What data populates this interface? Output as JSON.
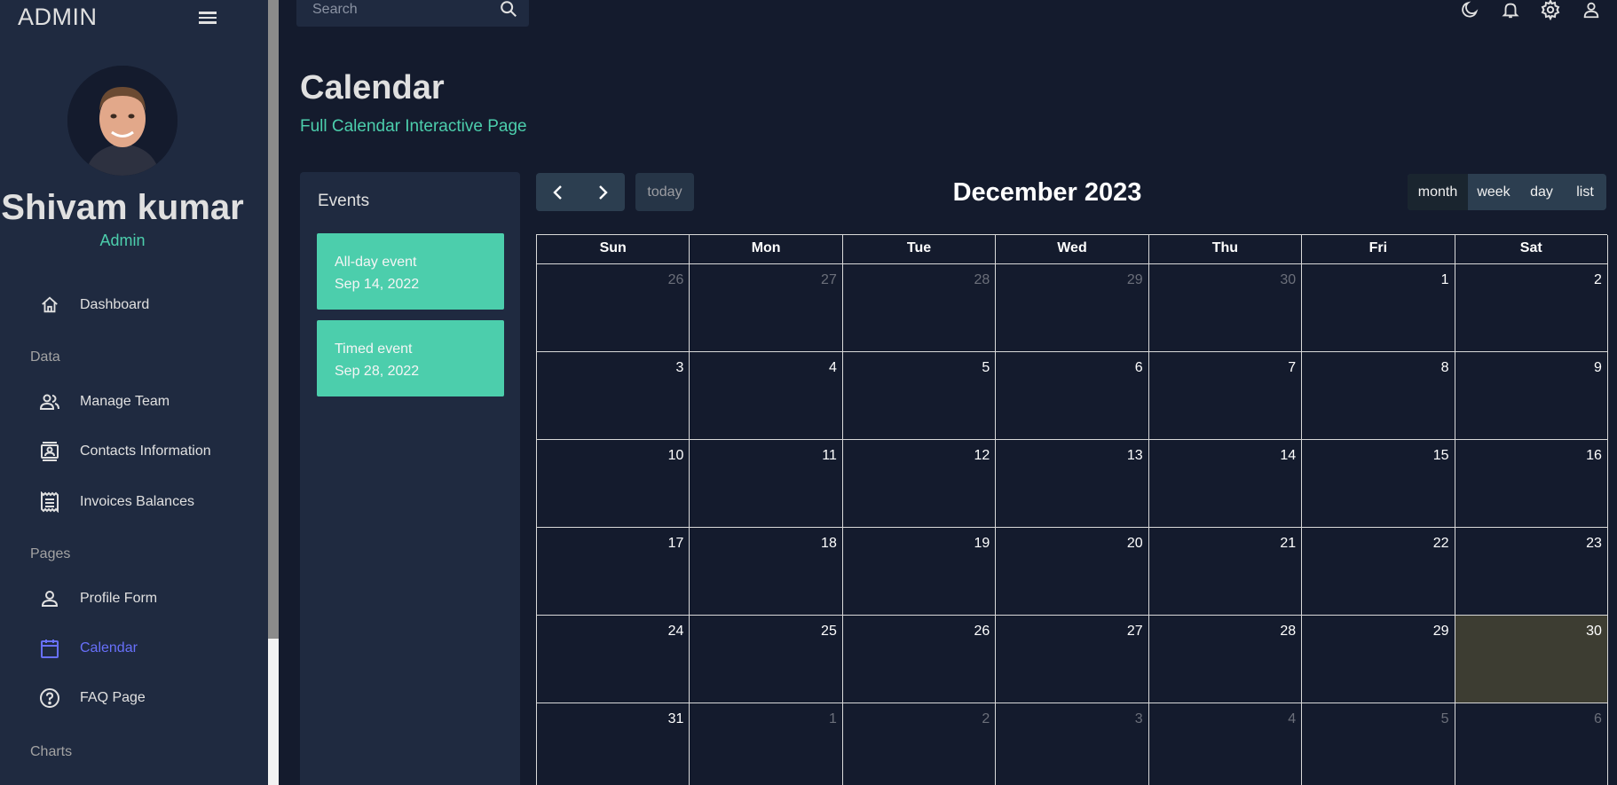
{
  "sidebar": {
    "brand": "ADMIN",
    "user": {
      "name": "Shivam kumar",
      "role": "Admin"
    },
    "items": [
      {
        "label": "Dashboard",
        "icon": "home-icon"
      },
      {
        "label": "Manage Team",
        "icon": "people-icon"
      },
      {
        "label": "Contacts Information",
        "icon": "contacts-icon"
      },
      {
        "label": "Invoices Balances",
        "icon": "receipt-icon"
      },
      {
        "label": "Profile Form",
        "icon": "person-icon"
      },
      {
        "label": "Calendar",
        "icon": "calendar-icon",
        "active": true
      },
      {
        "label": "FAQ Page",
        "icon": "help-icon"
      }
    ],
    "sections": [
      "Data",
      "Pages",
      "Charts"
    ]
  },
  "topbar": {
    "search_placeholder": "Search",
    "icons": [
      "dark-mode-icon",
      "notifications-icon",
      "settings-icon",
      "profile-icon"
    ]
  },
  "header": {
    "title": "Calendar",
    "subtitle": "Full Calendar Interactive Page"
  },
  "events": {
    "title": "Events",
    "items": [
      {
        "title": "All-day event",
        "date": "Sep 14, 2022"
      },
      {
        "title": "Timed event",
        "date": "Sep 28, 2022"
      }
    ]
  },
  "calendar": {
    "title": "December 2023",
    "today_label": "today",
    "views": [
      "month",
      "week",
      "day",
      "list"
    ],
    "active_view": "month",
    "weekdays": [
      "Sun",
      "Mon",
      "Tue",
      "Wed",
      "Thu",
      "Fri",
      "Sat"
    ],
    "weeks": [
      [
        "26",
        "27",
        "28",
        "29",
        "30",
        "1",
        "2"
      ],
      [
        "3",
        "4",
        "5",
        "6",
        "7",
        "8",
        "9"
      ],
      [
        "10",
        "11",
        "12",
        "13",
        "14",
        "15",
        "16"
      ],
      [
        "17",
        "18",
        "19",
        "20",
        "21",
        "22",
        "23"
      ],
      [
        "24",
        "25",
        "26",
        "27",
        "28",
        "29",
        "30"
      ],
      [
        "31",
        "1",
        "2",
        "3",
        "4",
        "5",
        "6"
      ]
    ],
    "today": "30",
    "colors": {
      "accent": "#4cceac",
      "active_nav": "#6870fa",
      "today_bg": "#3d3d32"
    }
  }
}
